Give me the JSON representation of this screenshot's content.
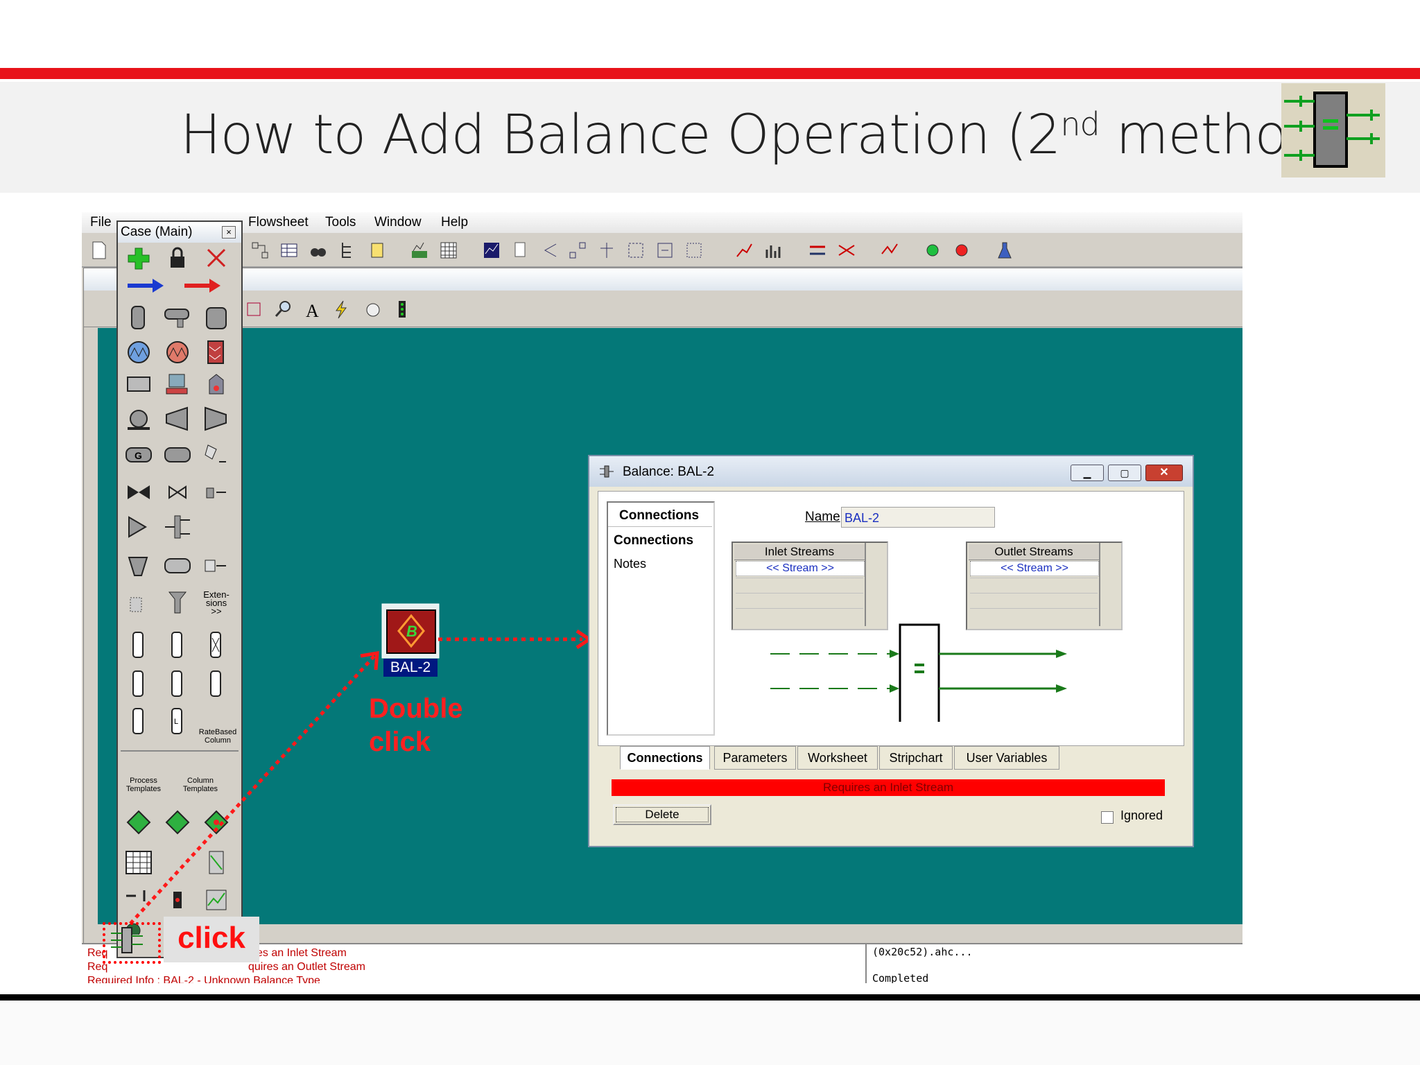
{
  "slide": {
    "title": "How to Add Balance Operation (2",
    "title_sup": "nd",
    "title_end": " method)",
    "accent_red": "#e8131a"
  },
  "app": {
    "menu": [
      "File",
      "Flowsheet",
      "Tools",
      "Window",
      "Help"
    ],
    "canvas_color": "#047878"
  },
  "palette": {
    "title": "Case (Main)",
    "labels": {
      "extensions": "Exten-\nsions\n>>",
      "ratebased": "RateBased\nColumn",
      "process_templates": "Process\nTemplates",
      "column_templates": "Column\nTemplates"
    }
  },
  "flowsheet": {
    "object_letter": "B",
    "object_label": "BAL-2",
    "annotation": "Double click",
    "annotation_line2": "click"
  },
  "dialog": {
    "title": "Balance: BAL-2",
    "nav_header": "Connections",
    "nav_items": [
      "Connections",
      "Notes"
    ],
    "name_label": "Name",
    "name_value": "BAL-2",
    "inlet_header": "Inlet Streams",
    "outlet_header": "Outlet Streams",
    "stream_placeholder": "<< Stream >>",
    "tabs": [
      "Connections",
      "Parameters",
      "Worksheet",
      "Stripchart",
      "User Variables"
    ],
    "status": "Requires an Inlet Stream",
    "delete_label": "Delete",
    "ignored_label": "Ignored"
  },
  "messages": {
    "left": [
      "Req",
      "Req",
      "Required Info : BAL-2 - Unknown Balance Type"
    ],
    "left_tail": [
      "es an Inlet Stream",
      "quires an Outlet Stream"
    ],
    "right": [
      "(0x20c52).ahc...",
      "Completed"
    ]
  },
  "callout": {
    "click": "click"
  }
}
